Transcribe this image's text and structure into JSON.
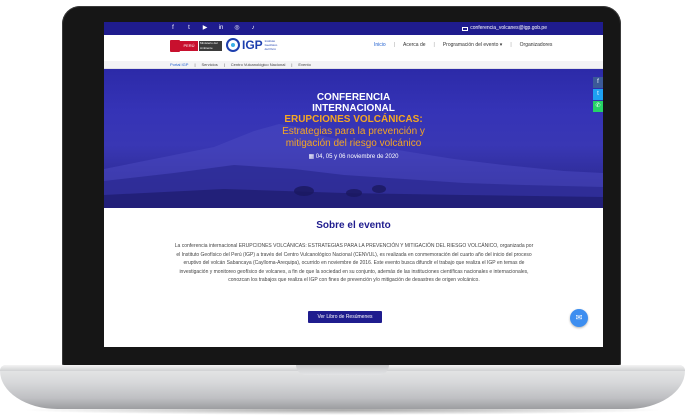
{
  "topbar": {
    "social_icons": [
      "facebook-icon",
      "twitter-icon",
      "youtube-icon",
      "linkedin-icon",
      "instagram-icon",
      "tiktok-icon"
    ],
    "social_glyphs": [
      "f",
      "t",
      "▶",
      "in",
      "◎",
      "♪"
    ],
    "email": "conferencia_volcanes@igp.gob.pe"
  },
  "header": {
    "logo_peru": "PERÚ",
    "logo_ministry": "Ministerio del Ambiente",
    "logo_igp": "IGP",
    "logo_igp_sub": "Instituto Geofísico del Perú",
    "nav": [
      "Inicio",
      "Acerca de",
      "Programación del evento",
      "Organizadores"
    ],
    "nav_separators": [
      "|",
      "|",
      "|"
    ]
  },
  "crumbs": {
    "items": [
      "Portal IGP",
      "Servicios",
      "Centro Vulcanológico Nacional",
      "Evento"
    ],
    "separators": [
      "|",
      "|",
      "|"
    ]
  },
  "hero": {
    "line1": "CONFERENCIA",
    "line2": "INTERNACIONAL",
    "line3": "ERUPCIONES VOLCÁNICAS:",
    "line4": "Estrategias para la prevención y",
    "line5": "mitigación del riesgo volcánico",
    "date": "04, 05 y 06 noviembre de 2020",
    "share_glyphs": [
      "f",
      "t",
      "✆"
    ],
    "share_colors": [
      "#3b5998",
      "#1da1f2",
      "#25d366"
    ]
  },
  "about": {
    "title": "Sobre el evento",
    "body": "La conferencia internacional ERUPCIONES VOLCÁNICAS: ESTRATEGIAS PARA LA PREVENCIÓN Y MITIGACIÓN DEL RIESGO VOLCÁNICO, organizada por el Instituto Geofísico del Perú (IGP) a través del Centro Vulcanológico Nacional (CENVUL), es realizada en conmemoración del cuarto año del inicio del proceso eruptivo del volcán Sabancaya (Caylloma-Arequipa), ocurrido en noviembre de 2016. Este evento busca difundir el trabajo que realiza el IGP en temas de investigación y monitoreo geofísico de volcanes, a fin de que la sociedad en su conjunto, además de las instituciones científicas nacionales e internacionales, conozcan los trabajos que realiza el IGP con fines de prevención y/o mitigación de desastres de origen volcánico.",
    "cta": "Ver Libro de Resúmenes"
  },
  "colors": {
    "primary": "#1f1c8e",
    "accent": "#f5a623",
    "link": "#1f5fd0",
    "fab": "#3d8ef0"
  }
}
